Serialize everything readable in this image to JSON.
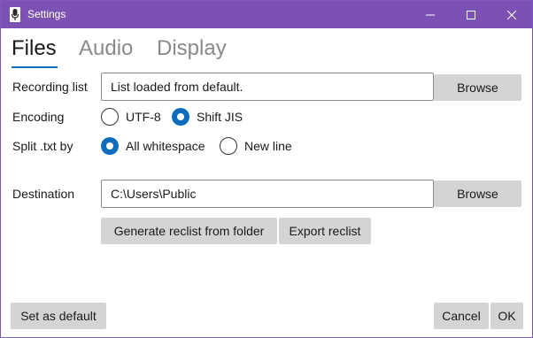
{
  "window": {
    "title": "Settings",
    "controls": {
      "minimize_icon": "minimize-icon",
      "maximize_icon": "maximize-icon",
      "close_icon": "close-icon"
    },
    "accent_color": "#7b52b4"
  },
  "tabs": [
    {
      "label": "Files",
      "active": true
    },
    {
      "label": "Audio",
      "active": false
    },
    {
      "label": "Display",
      "active": false
    }
  ],
  "files": {
    "recording_list": {
      "label": "Recording list",
      "value": "List loaded from default.",
      "browse_label": "Browse"
    },
    "encoding": {
      "label": "Encoding",
      "options": [
        {
          "label": "UTF-8",
          "selected": false
        },
        {
          "label": "Shift JIS",
          "selected": true
        }
      ]
    },
    "split": {
      "label": "Split .txt by",
      "options": [
        {
          "label": "All whitespace",
          "selected": true
        },
        {
          "label": "New line",
          "selected": false
        }
      ]
    },
    "destination": {
      "label": "Destination",
      "value": "C:\\Users\\Public",
      "browse_label": "Browse"
    },
    "generate_label": "Generate reclist from folder",
    "export_label": "Export reclist"
  },
  "footer": {
    "set_default_label": "Set as default",
    "cancel_label": "Cancel",
    "ok_label": "OK"
  },
  "colors": {
    "selection": "#0f6cbd",
    "button_bg": "#d4d4d4"
  }
}
